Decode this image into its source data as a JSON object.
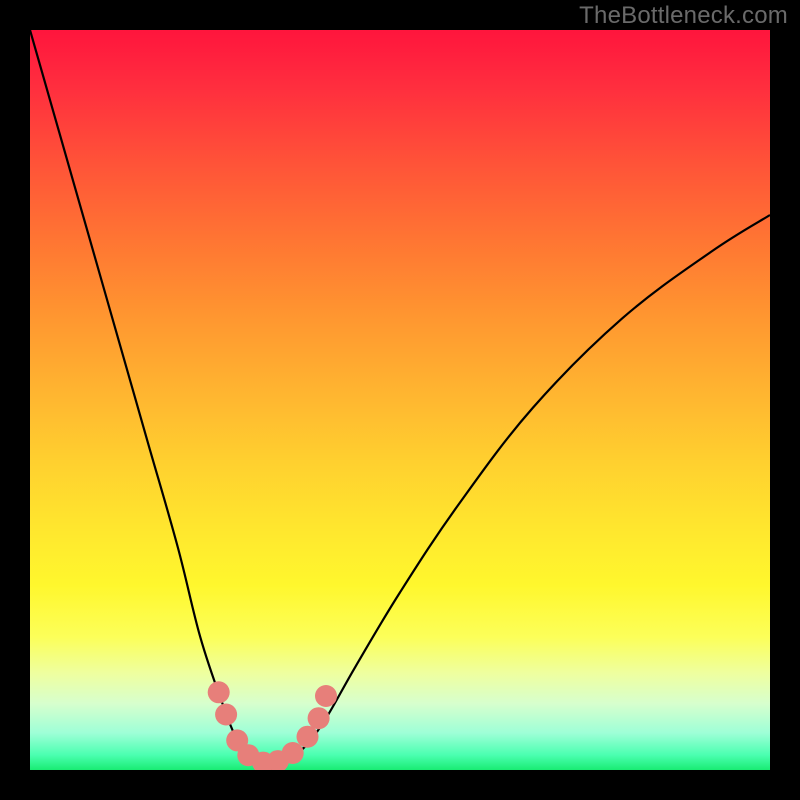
{
  "watermark": {
    "text": "TheBottleneck.com"
  },
  "chart_data": {
    "type": "line",
    "title": "",
    "xlabel": "",
    "ylabel": "",
    "xlim": [
      0,
      100
    ],
    "ylim": [
      0,
      100
    ],
    "grid": false,
    "series": [
      {
        "name": "bottleneck-curve",
        "x": [
          0,
          4,
          8,
          12,
          16,
          20,
          23,
          26,
          28,
          30,
          32,
          34,
          37,
          40,
          44,
          50,
          58,
          68,
          80,
          92,
          100
        ],
        "y": [
          100,
          86,
          72,
          58,
          44,
          30,
          18,
          9,
          4,
          1,
          0,
          1,
          3,
          7,
          14,
          24,
          36,
          49,
          61,
          70,
          75
        ]
      }
    ],
    "markers": {
      "color": "#e77f7a",
      "points": [
        {
          "x": 25.5,
          "y": 10.5
        },
        {
          "x": 26.5,
          "y": 7.5
        },
        {
          "x": 28.0,
          "y": 4.0
        },
        {
          "x": 29.5,
          "y": 2.0
        },
        {
          "x": 31.5,
          "y": 1.0
        },
        {
          "x": 33.5,
          "y": 1.2
        },
        {
          "x": 35.5,
          "y": 2.3
        },
        {
          "x": 37.5,
          "y": 4.5
        },
        {
          "x": 39.0,
          "y": 7.0
        },
        {
          "x": 40.0,
          "y": 10.0
        }
      ]
    },
    "background_gradient": {
      "stops": [
        {
          "pos": 0,
          "color": "#ff153d"
        },
        {
          "pos": 50,
          "color": "#ffb230"
        },
        {
          "pos": 78,
          "color": "#fcff59"
        },
        {
          "pos": 100,
          "color": "#19ec73"
        }
      ]
    }
  }
}
